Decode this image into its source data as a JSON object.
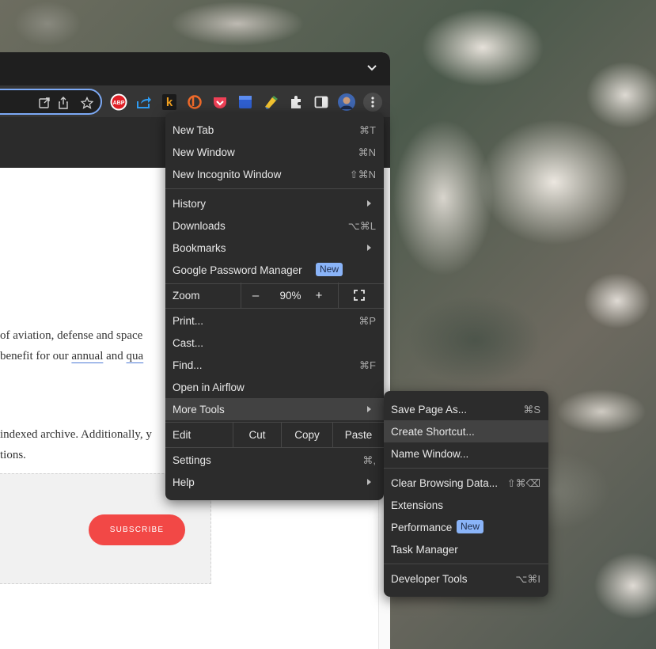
{
  "browser": {
    "page_text": {
      "line1": "of aviation, defense and space",
      "line2_prefix": "benefit for our ",
      "line2_link1": "annual",
      "line2_mid": " and ",
      "line2_link2": "qua",
      "line3": "indexed archive. Additionally, y",
      "line4": "tions.",
      "subscribe_label": "SUBSCRIBE"
    },
    "extensions": [
      "adblock-plus-icon",
      "share-extension-icon",
      "k-extension-icon",
      "b-extension-icon",
      "pocket-icon",
      "blue-extension-icon",
      "highlighter-icon",
      "puzzle-icon",
      "sidepanel-icon",
      "profile-avatar",
      "kebab-menu-icon"
    ],
    "abp_label": "ABP"
  },
  "main_menu": {
    "items": [
      {
        "label": "New Tab",
        "shortcut": "⌘T"
      },
      {
        "label": "New Window",
        "shortcut": "⌘N"
      },
      {
        "label": "New Incognito Window",
        "shortcut": "⇧⌘N"
      },
      {
        "label": "History"
      },
      {
        "label": "Downloads",
        "shortcut": "⌥⌘L"
      },
      {
        "label": "Bookmarks"
      },
      {
        "label": "Google Password Manager",
        "badge": "New"
      },
      {
        "label": "Print...",
        "shortcut": "⌘P"
      },
      {
        "label": "Cast..."
      },
      {
        "label": "Find...",
        "shortcut": "⌘F"
      },
      {
        "label": "Open in Airflow"
      },
      {
        "label": "More Tools"
      },
      {
        "label": "Settings",
        "shortcut": "⌘,"
      },
      {
        "label": "Help"
      }
    ],
    "zoom": {
      "label": "Zoom",
      "minus": "–",
      "value": "90%",
      "plus": "+"
    },
    "edit": {
      "label": "Edit",
      "cut": "Cut",
      "copy": "Copy",
      "paste": "Paste"
    }
  },
  "sub_menu": {
    "items": [
      {
        "label": "Save Page As...",
        "shortcut": "⌘S"
      },
      {
        "label": "Create Shortcut..."
      },
      {
        "label": "Name Window..."
      },
      {
        "label": "Clear Browsing Data...",
        "shortcut": "⇧⌘⌫"
      },
      {
        "label": "Extensions"
      },
      {
        "label": "Performance",
        "badge": "New"
      },
      {
        "label": "Task Manager"
      },
      {
        "label": "Developer Tools",
        "shortcut": "⌥⌘I"
      }
    ]
  },
  "colors": {
    "accent": "#8ab4f8",
    "subscribe": "#f24846",
    "menu_bg": "#2c2c2c"
  }
}
